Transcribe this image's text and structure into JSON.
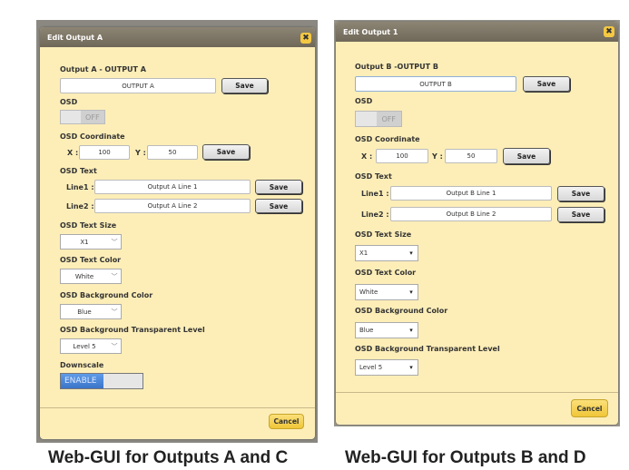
{
  "panel_a": {
    "title": "Edit Output A",
    "name_label": "Output A - OUTPUT A",
    "name_value": "OUTPUT A",
    "save": "Save",
    "osd_label": "OSD",
    "osd_state": "OFF",
    "coord_label": "OSD Coordinate",
    "x_label": "X :",
    "x_value": "100",
    "y_label": "Y :",
    "y_value": "50",
    "text_label": "OSD Text",
    "line1_label": "Line1 :",
    "line1_value": "Output A Line 1",
    "line2_label": "Line2 :",
    "line2_value": "Output A Line 2",
    "size_label": "OSD Text Size",
    "size_value": "X1",
    "color_label": "OSD Text Color",
    "color_value": "White",
    "bg_label": "OSD Background Color",
    "bg_value": "Blue",
    "trans_label": "OSD Background Transparent Level",
    "trans_value": "Level 5",
    "downscale_label": "Downscale",
    "downscale_state": "ENABLE",
    "cancel": "Cancel",
    "caption": "Web-GUI for Outputs A and C"
  },
  "panel_b": {
    "title": "Edit Output 1",
    "name_label": "Output B -OUTPUT  B",
    "name_value": "OUTPUT B",
    "save": "Save",
    "osd_label": "OSD",
    "osd_state": "OFF",
    "coord_label": "OSD Coordinate",
    "x_label": "X :",
    "x_value": "100",
    "y_label": "Y :",
    "y_value": "50",
    "text_label": "OSD Text",
    "line1_label": "Line1 :",
    "line1_value": "Output B Line 1",
    "line2_label": "Line2 :",
    "line2_value": "Output B Line 2",
    "size_label": "OSD Text Size",
    "size_value": "X1",
    "color_label": "OSD Text Color",
    "color_value": "White",
    "bg_label": "OSD Background Color",
    "bg_value": "Blue",
    "trans_label": "OSD Background Transparent Level",
    "trans_value": "Level 5",
    "cancel": "Cancel",
    "caption": "Web-GUI for Outputs B and D"
  }
}
